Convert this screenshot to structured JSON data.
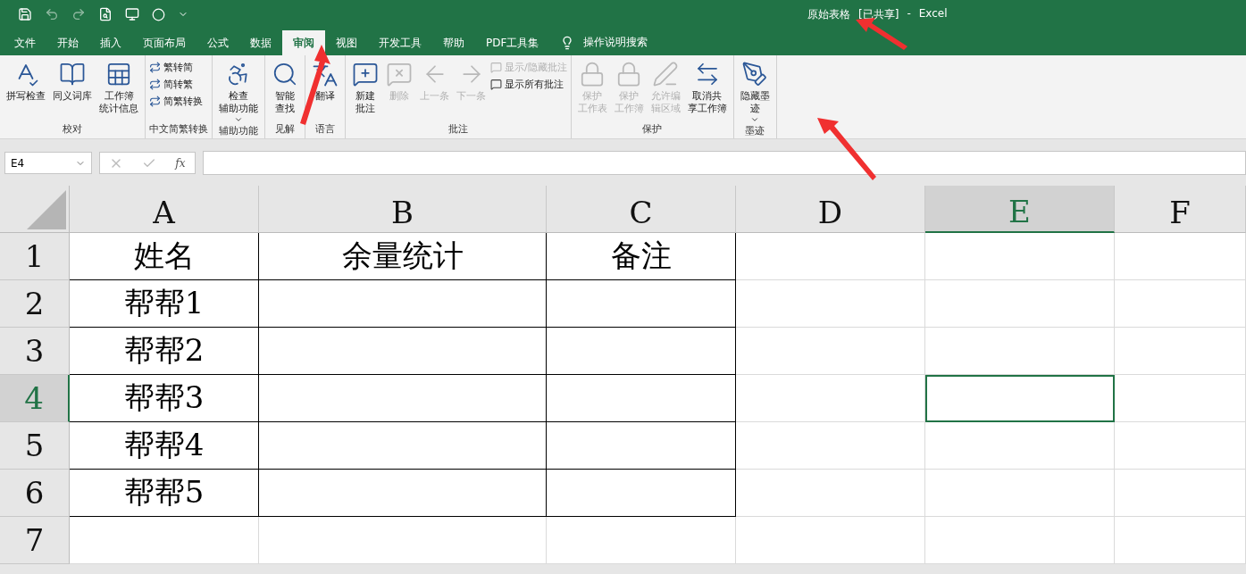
{
  "window": {
    "title_parts": [
      "原始表格",
      "[已共享]",
      "-",
      "Excel"
    ]
  },
  "tabs": [
    {
      "label": "文件",
      "selected": false
    },
    {
      "label": "开始",
      "selected": false
    },
    {
      "label": "插入",
      "selected": false
    },
    {
      "label": "页面布局",
      "selected": false
    },
    {
      "label": "公式",
      "selected": false
    },
    {
      "label": "数据",
      "selected": false
    },
    {
      "label": "审阅",
      "selected": true
    },
    {
      "label": "视图",
      "selected": false
    },
    {
      "label": "开发工具",
      "selected": false
    },
    {
      "label": "帮助",
      "selected": false
    },
    {
      "label": "PDF工具集",
      "selected": false
    }
  ],
  "tell_me": {
    "label": "操作说明搜索"
  },
  "ribbon_groups": [
    {
      "label": "校对",
      "commands": [
        {
          "kind": "large",
          "label_lines": [
            "拼写检查"
          ],
          "disabled": false
        },
        {
          "kind": "large",
          "label_lines": [
            "同义词库"
          ],
          "disabled": false
        },
        {
          "kind": "large",
          "label_lines": [
            "工作簿",
            "统计信息"
          ],
          "disabled": false
        }
      ]
    },
    {
      "label": "中文简繁转换",
      "commands": [
        {
          "kind": "small",
          "label": "繁转简",
          "disabled": false
        },
        {
          "kind": "small",
          "label": "简转繁",
          "disabled": false
        },
        {
          "kind": "small",
          "label": "简繁转换",
          "disabled": false
        }
      ]
    },
    {
      "label": "辅助功能",
      "commands": [
        {
          "kind": "large",
          "label_lines": [
            "检查",
            "辅助功能"
          ],
          "disabled": false,
          "has_menu": true
        }
      ]
    },
    {
      "label": "见解",
      "commands": [
        {
          "kind": "large",
          "label_lines": [
            "智能",
            "查找"
          ],
          "disabled": false
        }
      ]
    },
    {
      "label": "语言",
      "commands": [
        {
          "kind": "large",
          "label_lines": [
            "翻译"
          ],
          "disabled": false
        }
      ]
    },
    {
      "label": "批注",
      "commands": [
        {
          "kind": "large",
          "label_lines": [
            "新建",
            "批注"
          ],
          "disabled": false
        },
        {
          "kind": "large",
          "label_lines": [
            "删除"
          ],
          "disabled": true
        },
        {
          "kind": "large",
          "label_lines": [
            "上一条"
          ],
          "disabled": true
        },
        {
          "kind": "large",
          "label_lines": [
            "下一条"
          ],
          "disabled": true
        },
        {
          "kind": "small",
          "label": "显示/隐藏批注",
          "disabled": true
        },
        {
          "kind": "small",
          "label": "显示所有批注",
          "disabled": false
        }
      ]
    },
    {
      "label": "保护",
      "commands": [
        {
          "kind": "large",
          "label_lines": [
            "保护",
            "工作表"
          ],
          "disabled": true
        },
        {
          "kind": "large",
          "label_lines": [
            "保护",
            "工作簿"
          ],
          "disabled": true
        },
        {
          "kind": "large",
          "label_lines": [
            "允许编",
            "辑区域"
          ],
          "disabled": true
        },
        {
          "kind": "large",
          "label_lines": [
            "取消共",
            "享工作簿"
          ],
          "disabled": false
        }
      ]
    },
    {
      "label": "墨迹",
      "commands": [
        {
          "kind": "large",
          "label_lines": [
            "隐藏墨",
            "迹"
          ],
          "disabled": false,
          "has_menu": true
        }
      ]
    }
  ],
  "name_box": {
    "value": "E4"
  },
  "formula_bar": {
    "fx": "fx"
  },
  "grid": {
    "columns": [
      {
        "label": "A",
        "selected": false
      },
      {
        "label": "B",
        "selected": false
      },
      {
        "label": "C",
        "selected": false
      },
      {
        "label": "D",
        "selected": false
      },
      {
        "label": "E",
        "selected": true
      },
      {
        "label": "F",
        "selected": false
      }
    ],
    "rows": [
      {
        "number": "1",
        "selected": false,
        "bordered": true,
        "cells": [
          "姓名",
          "余量统计",
          "备注"
        ]
      },
      {
        "number": "2",
        "selected": false,
        "bordered": true,
        "cells": [
          "帮帮1"
        ]
      },
      {
        "number": "3",
        "selected": false,
        "bordered": true,
        "cells": [
          "帮帮2"
        ]
      },
      {
        "number": "4",
        "selected": true,
        "bordered": true,
        "cells": [
          "帮帮3"
        ]
      },
      {
        "number": "5",
        "selected": false,
        "bordered": true,
        "cells": [
          "帮帮4"
        ]
      },
      {
        "number": "6",
        "selected": false,
        "bordered": true,
        "cells": [
          "帮帮5"
        ]
      },
      {
        "number": "7",
        "selected": false,
        "bordered": false,
        "cells": []
      }
    ]
  }
}
